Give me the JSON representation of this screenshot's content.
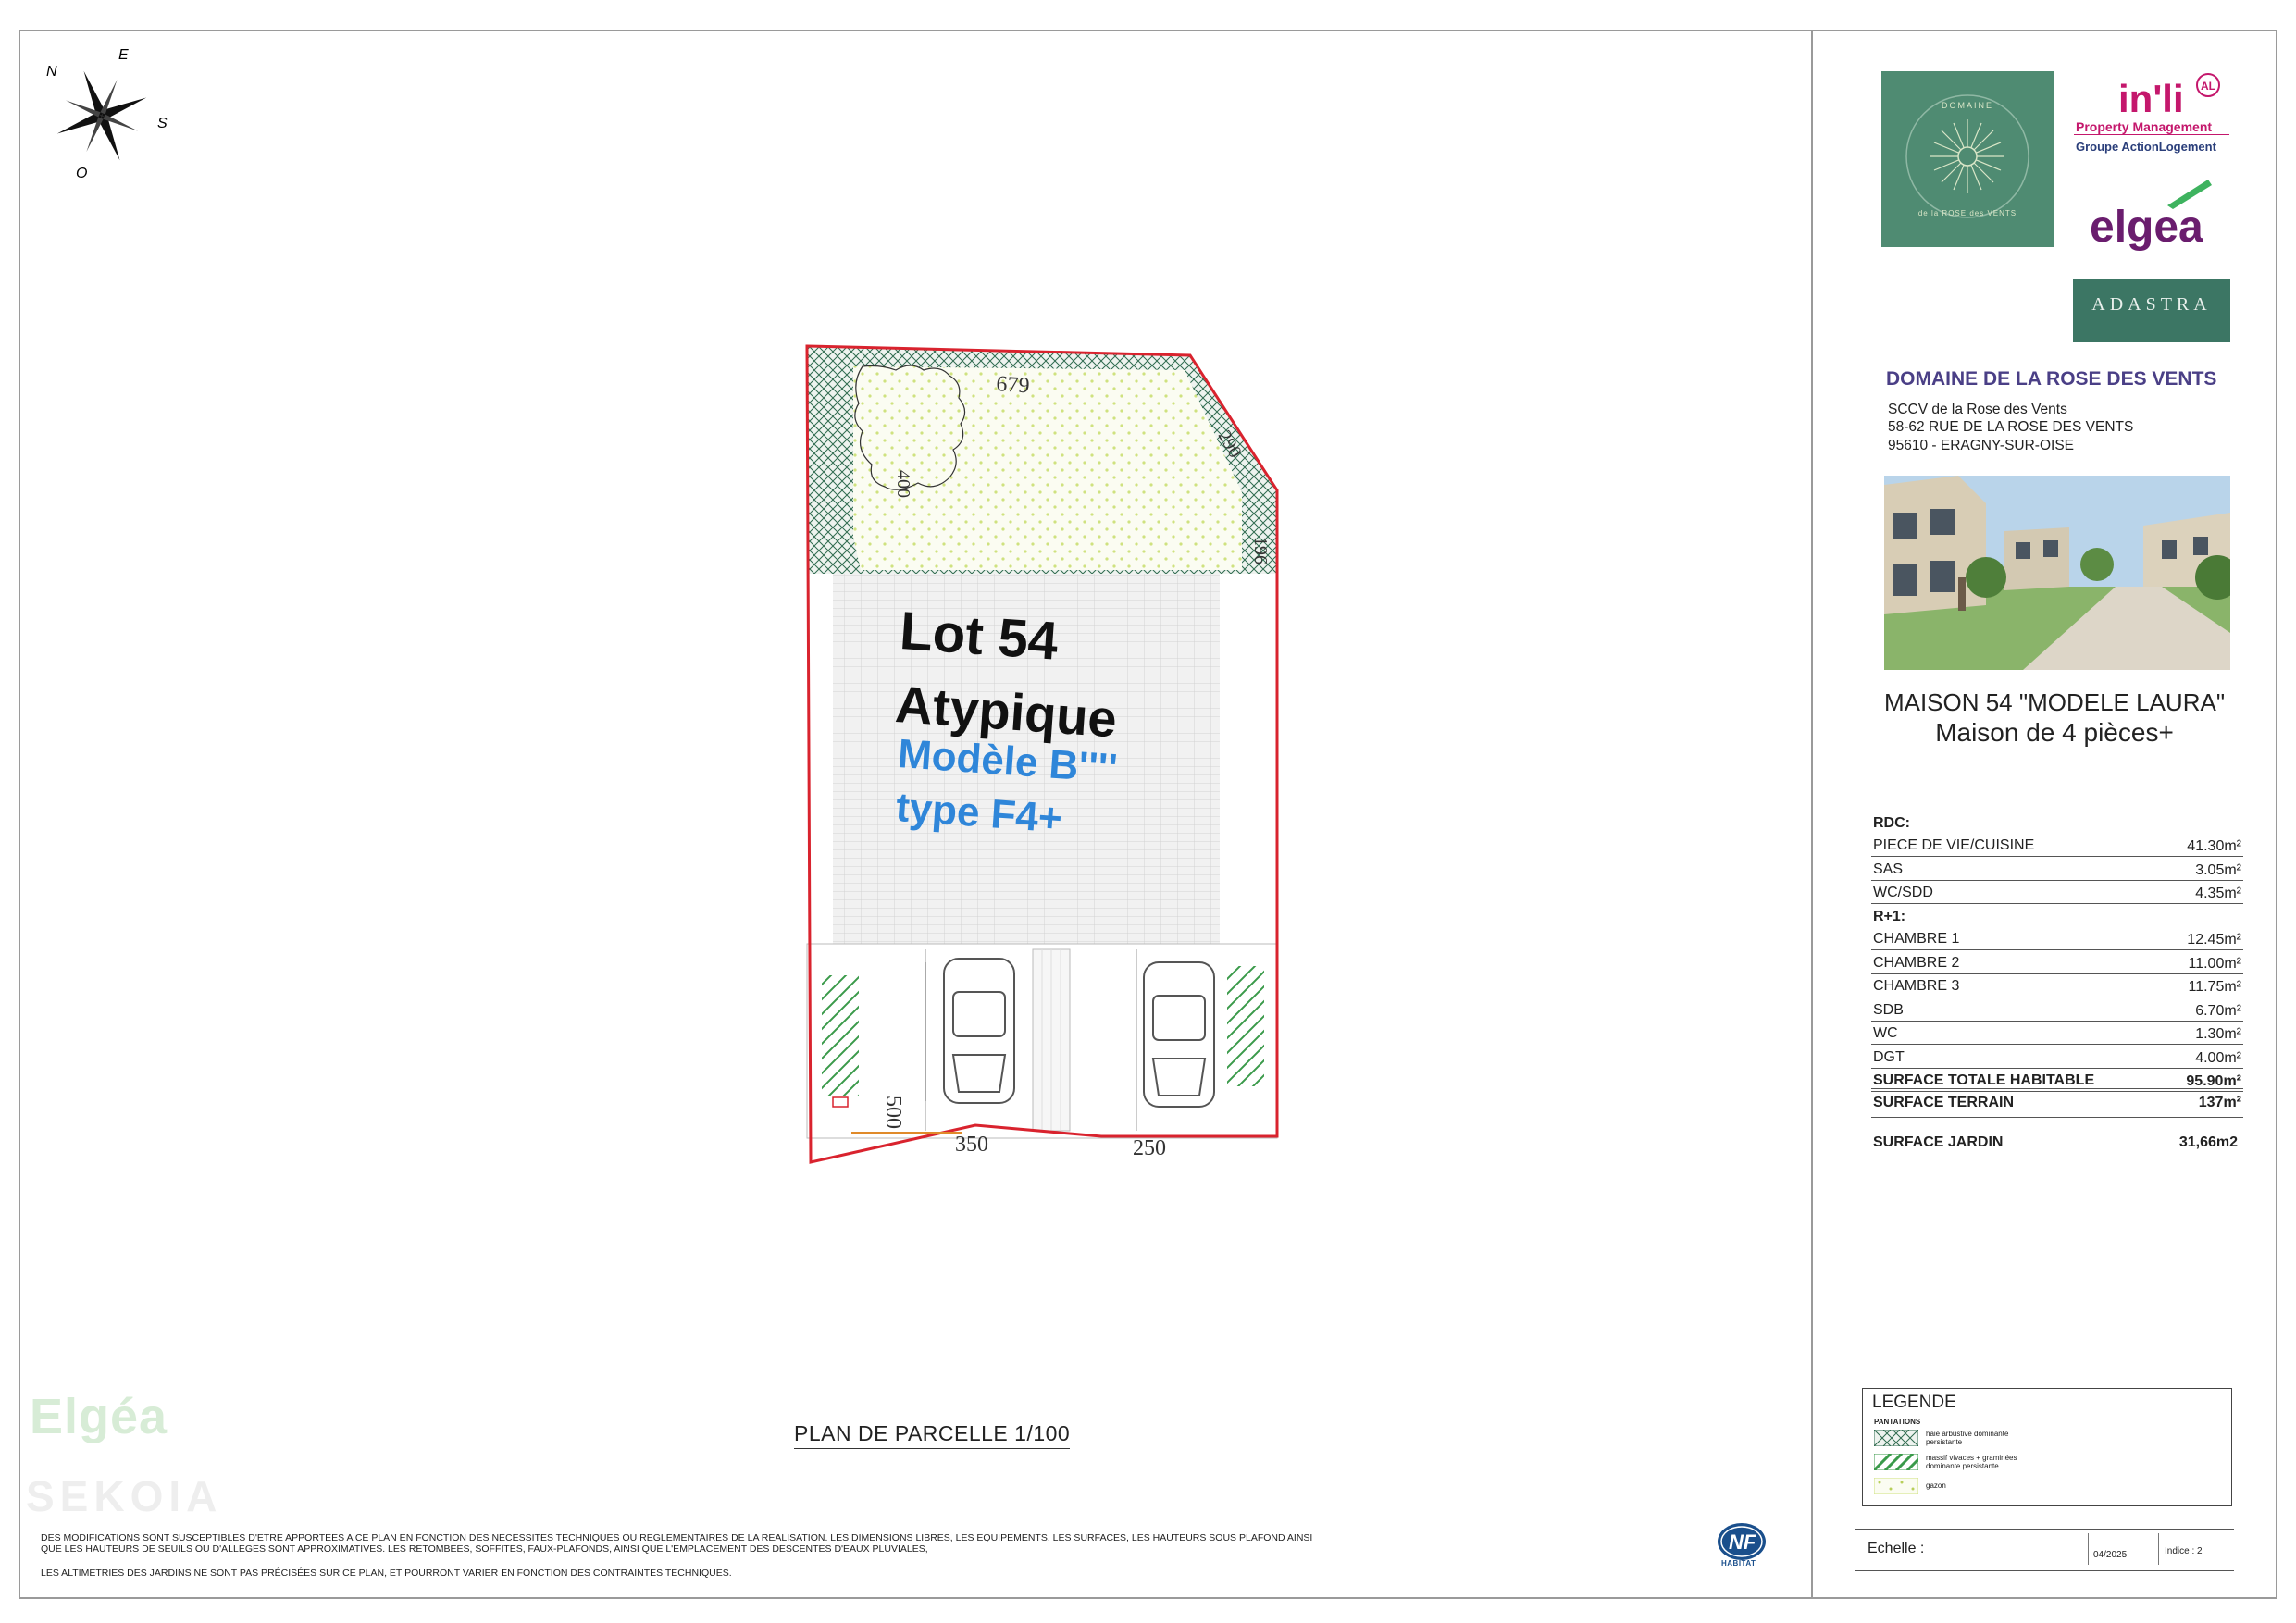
{
  "compass": {
    "n": "N",
    "e": "E",
    "s": "S",
    "o": "O"
  },
  "plan": {
    "lot": "Lot 54",
    "type": "Atypique",
    "model": "Modèle B''''",
    "variant": "type F4+",
    "dims": {
      "top": "679",
      "tree": "400",
      "diag": "290",
      "side": "196",
      "park_depth": "500",
      "park1": "350",
      "park2": "250"
    },
    "caption": "PLAN DE PARCELLE 1/100"
  },
  "disclaimer": {
    "line1": "DES MODIFICATIONS SONT SUSCEPTIBLES D'ETRE APPORTEES A CE PLAN EN FONCTION DES NECESSITES TECHNIQUES OU REGLEMENTAIRES DE LA REALISATION. LES DIMENSIONS LIBRES, LES EQUIPEMENTS, LES SURFACES, LES HAUTEURS SOUS PLAFOND AINSI",
    "line2": "QUE LES HAUTEURS DE SEUILS OU D'ALLEGES SONT APPROXIMATIVES. LES RETOMBEES, SOFFITES, FAUX-PLAFONDS, AINSI QUE L'EMPLACEMENT DES DESCENTES D'EAUX PLUVIALES,",
    "line3": "LES ALTIMETRIES DES JARDINS NE SONT PAS PRÉCISÉES SUR CE PLAN, ET POURRONT VARIER EN FONCTION DES CONTRAINTES TECHNIQUES."
  },
  "watermark": {
    "brand": "Elgéa",
    "sub": "SEKOIA"
  },
  "nf": {
    "mark": "NF",
    "label": "HABITAT"
  },
  "logos": {
    "domaine_top": "DOMAINE",
    "domaine_bottom": "de la ROSE des VENTS",
    "inli": "in'li",
    "inli_al": "AL",
    "inli_pm": "Property Management",
    "inli_group": "Groupe ActionLogement",
    "elgea": "elgea",
    "adastra": "ADASTRA"
  },
  "project": {
    "title": "DOMAINE DE LA ROSE DES VENTS",
    "company": "SCCV de la Rose des Vents",
    "street": "58-62 RUE DE LA ROSE DES VENTS",
    "city": "95610 - ERAGNY-SUR-OISE"
  },
  "house": {
    "title": "MAISON 54 \"MODELE LAURA\"",
    "subtitle": "Maison de 4 pièces+"
  },
  "surfaces": {
    "rdc_label": "RDC:",
    "rdc": [
      {
        "label": "PIECE DE VIE/CUISINE",
        "value": "41.30m²"
      },
      {
        "label": "SAS",
        "value": "3.05m²"
      },
      {
        "label": "WC/SDD",
        "value": "4.35m²"
      }
    ],
    "r1_label": "R+1:",
    "r1": [
      {
        "label": "CHAMBRE 1",
        "value": "12.45m²"
      },
      {
        "label": "CHAMBRE 2",
        "value": "11.00m²"
      },
      {
        "label": "CHAMBRE 3",
        "value": "11.75m²"
      },
      {
        "label": "SDB",
        "value": "6.70m²"
      },
      {
        "label": "WC",
        "value": "1.30m²"
      },
      {
        "label": "DGT",
        "value": "4.00m²"
      }
    ],
    "total_label": "SURFACE TOTALE HABITABLE",
    "total_value": "95.90m²",
    "terrain_label": "SURFACE TERRAIN",
    "terrain_value": "137m²",
    "jardin_label": "SURFACE JARDIN",
    "jardin_value": "31,66m2"
  },
  "legend": {
    "title": "LEGENDE",
    "subtitle": "PANTATIONS",
    "items": [
      "haie arbustive dominante persistante",
      "massif vivaces + graminées dominante persistante",
      "gazon"
    ]
  },
  "cartouche": {
    "echelle": "Echelle :",
    "date": "04/2025",
    "indice": "Indice : 2"
  },
  "colors": {
    "parcel": "#d9232e",
    "hedge": "#2f6b4f",
    "lawn": "#cfe27f",
    "accent": "#2f86d9",
    "brand": "#4a3f86"
  }
}
